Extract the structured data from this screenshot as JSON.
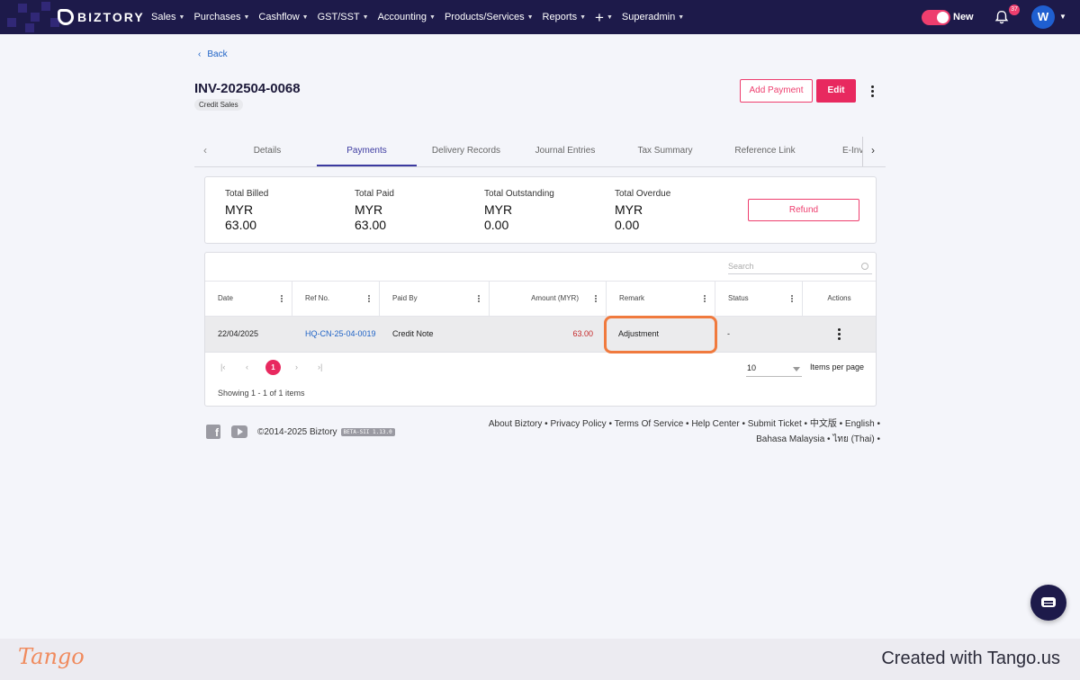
{
  "nav": {
    "brand": "BIZTORY",
    "menu": [
      "Sales",
      "Purchases",
      "Cashflow",
      "GST/SST",
      "Accounting",
      "Products/Services",
      "Reports"
    ],
    "plus": "+",
    "superadmin": "Superadmin",
    "toggle_label": "New",
    "notification_count": "37",
    "avatar_initial": "W"
  },
  "header": {
    "back_label": "Back",
    "title": "INV-202504-0068",
    "type": "Credit Sales",
    "add_payment_label": "Add Payment",
    "edit_label": "Edit"
  },
  "tabs": [
    "Details",
    "Payments",
    "Delivery Records",
    "Journal Entries",
    "Tax Summary",
    "Reference Link",
    "E-Inv"
  ],
  "active_tab": "Payments",
  "summary": {
    "items": [
      {
        "label": "Total Billed",
        "currency": "MYR",
        "value": "63.00"
      },
      {
        "label": "Total Paid",
        "currency": "MYR",
        "value": "63.00"
      },
      {
        "label": "Total Outstanding",
        "currency": "MYR",
        "value": "0.00"
      },
      {
        "label": "Total Overdue",
        "currency": "MYR",
        "value": "0.00"
      }
    ],
    "refund_label": "Refund"
  },
  "table": {
    "search_placeholder": "Search",
    "columns": [
      "Date",
      "Ref No.",
      "Paid By",
      "Amount (MYR)",
      "Remark",
      "Status",
      "Actions"
    ],
    "rows": [
      {
        "date": "22/04/2025",
        "ref": "HQ-CN-25-04-0019",
        "paid_by": "Credit Note",
        "amount": "63.00",
        "remark": "Adjustment",
        "status": "-"
      }
    ],
    "current_page": "1",
    "items_per_page": "10",
    "items_per_page_label": "Items per page",
    "showing": "Showing 1 - 1 of 1 items"
  },
  "footer": {
    "copyright": "©2014-2025 Biztory",
    "version": "BETA-SII 1.13.0",
    "links_line1": [
      "About Biztory",
      "Privacy Policy",
      "Terms Of Service",
      "Help Center",
      "Submit Ticket",
      "中文版",
      "English"
    ],
    "links_line2": [
      "Bahasa Malaysia",
      "ไทย (Thai)"
    ]
  },
  "tango": {
    "logo": "Tango",
    "credit": "Created with Tango.us"
  },
  "colors": {
    "nav_bg": "#1d1a4a",
    "accent": "#e8295f",
    "link": "#1f63c6",
    "tab_active": "#3c3aa0",
    "highlight": "#f07a3e"
  }
}
